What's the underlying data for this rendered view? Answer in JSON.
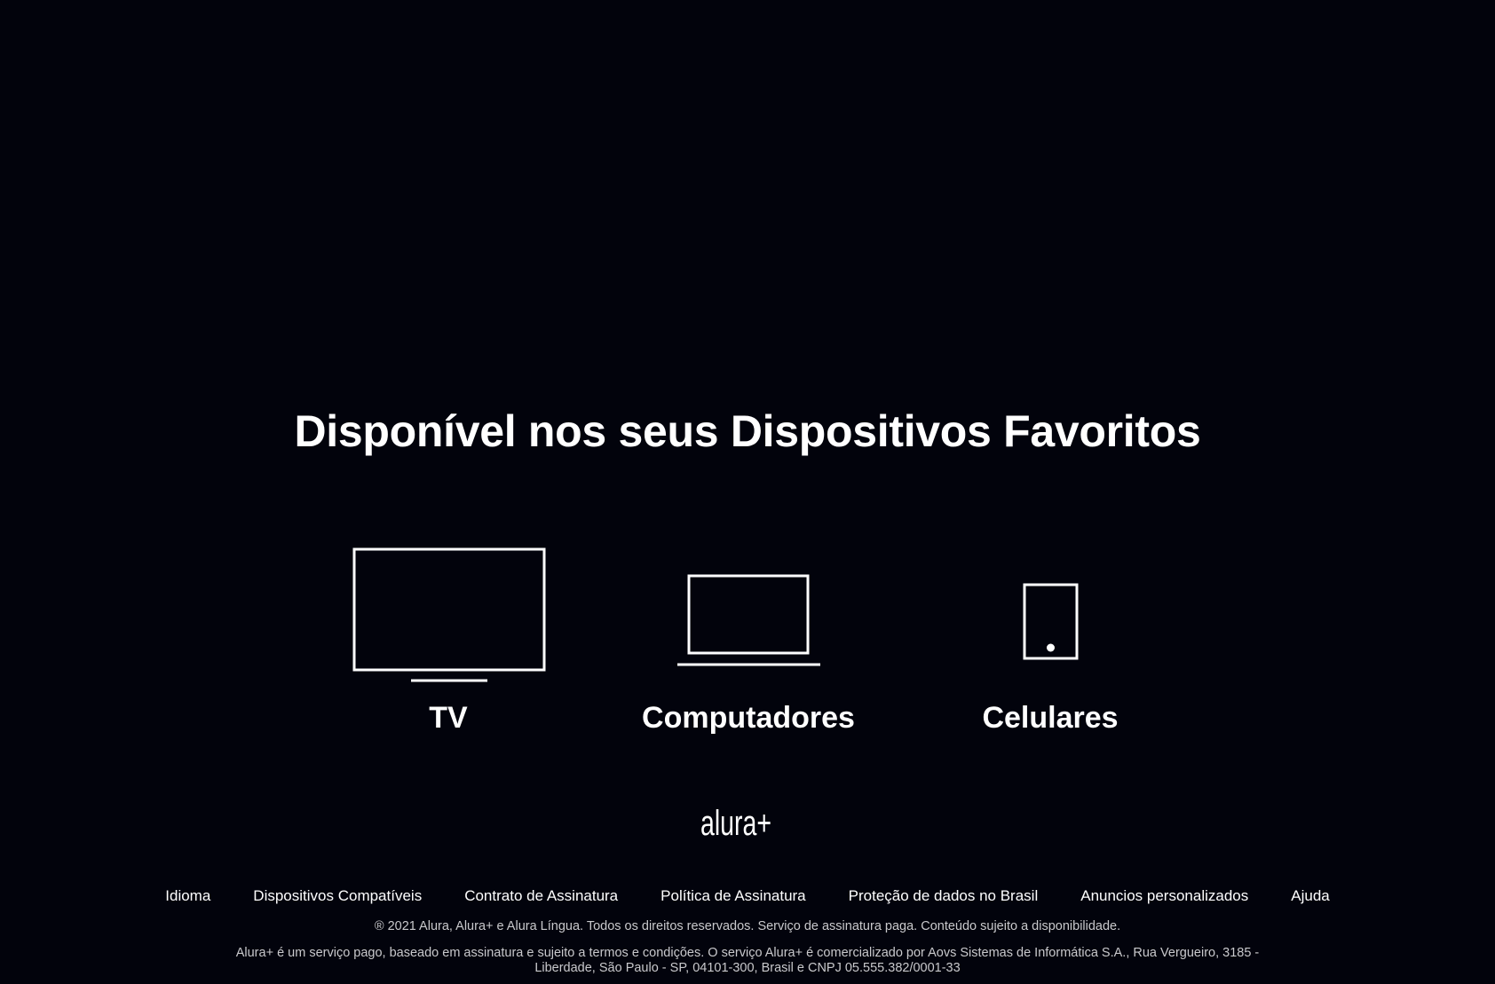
{
  "section": {
    "title": "Disponível nos seus Dispositivos Favoritos",
    "devices": [
      {
        "label": "TV",
        "icon": "tv-icon"
      },
      {
        "label": "Computadores",
        "icon": "laptop-icon"
      },
      {
        "label": "Celulares",
        "icon": "mobile-phone-icon"
      }
    ]
  },
  "footer": {
    "logo_text": "alura+",
    "links": [
      "Idioma",
      "Dispositivos Compatíveis",
      "Contrato de Assinatura",
      "Política de Assinatura",
      "Proteção de dados no Brasil",
      "Anuncios personalizados",
      "Ajuda"
    ],
    "copyright": "® 2021 Alura, Alura+ e Alura Língua. Todos os direitos reservados. Serviço de assinatura paga. Conteúdo sujeito a disponibilidade.",
    "legal": "Alura+ é um serviço pago, baseado em assinatura e sujeito a termos e condições. O serviço Alura+ é comercializado por Aovs Sistemas de Informática S.A., Rua Vergueiro, 3185 - Liberdade, São Paulo - SP, 04101-300, Brasil e CNPJ 05.555.382/0001-33"
  },
  "colors": {
    "background": "#02030c",
    "text": "#ffffff",
    "muted_text": "#c9c9cc"
  }
}
